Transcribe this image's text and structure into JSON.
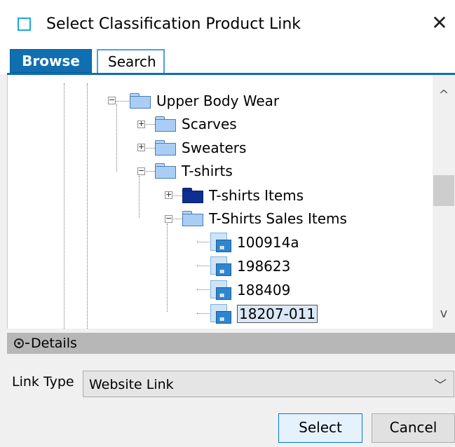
{
  "window": {
    "title": "Select Classification Product Link",
    "close_glyph": "✕"
  },
  "tabs": [
    {
      "label": "Browse",
      "active": true
    },
    {
      "label": "Search",
      "active": false
    }
  ],
  "tree": {
    "nodes": [
      {
        "label": "Upper Body Wear",
        "icon": "folder-icon",
        "expander": "minus"
      },
      {
        "label": "Scarves",
        "icon": "folder-icon",
        "expander": "plus"
      },
      {
        "label": "Sweaters",
        "icon": "folder-icon",
        "expander": "plus"
      },
      {
        "label": "T-shirts",
        "icon": "folder-icon",
        "expander": "minus"
      },
      {
        "label": "T-shirts Items",
        "icon": "folder-dark-icon",
        "expander": "plus"
      },
      {
        "label": "T-Shirts Sales Items",
        "icon": "folder-icon",
        "expander": "minus"
      },
      {
        "label": "100914a",
        "icon": "product-icon"
      },
      {
        "label": "198623",
        "icon": "product-icon"
      },
      {
        "label": "188409",
        "icon": "product-icon"
      },
      {
        "label": "18207-011",
        "icon": "product-icon",
        "selected": true
      }
    ]
  },
  "scrollbar": {
    "up_glyph": "^",
    "down_glyph": "v"
  },
  "details": {
    "label": "Details"
  },
  "link_type": {
    "label": "Link Type",
    "value": "Website Link",
    "arrow_glyph": "﹀"
  },
  "buttons": {
    "select": "Select",
    "cancel": "Cancel"
  },
  "colors": {
    "accent": "#0f6fb1",
    "details_bar": "#b7b7b7",
    "dark_folder": "#0d2f8f"
  }
}
